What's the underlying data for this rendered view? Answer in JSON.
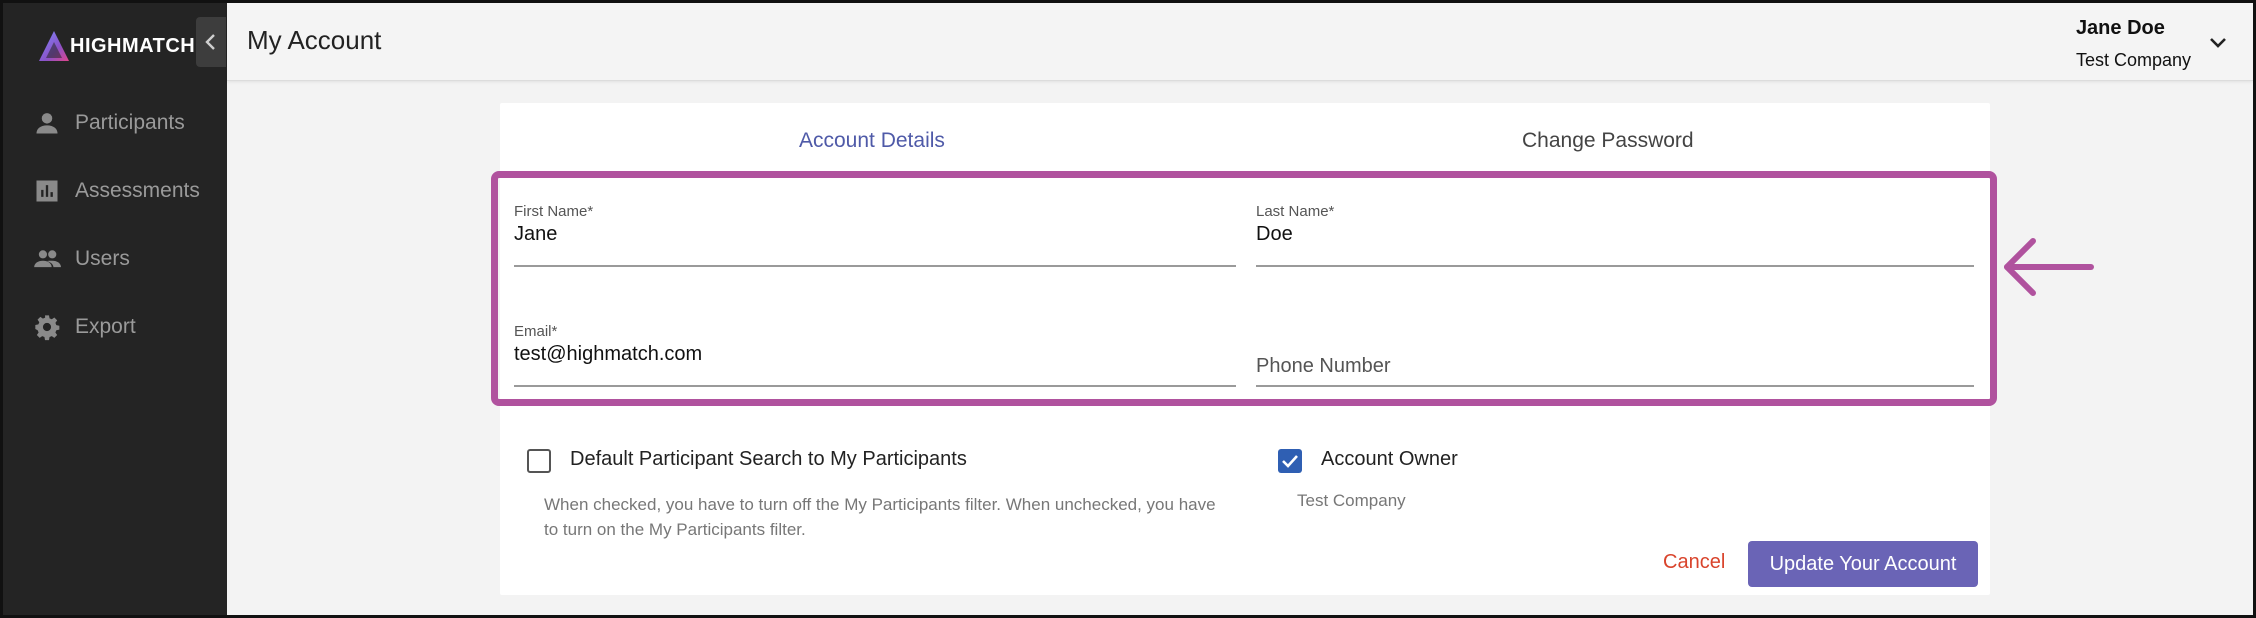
{
  "brand": {
    "name": "HIGHMATCH"
  },
  "sidebar": {
    "items": [
      {
        "label": "Participants",
        "icon": "person-icon"
      },
      {
        "label": "Assessments",
        "icon": "bar-chart-icon"
      },
      {
        "label": "Users",
        "icon": "group-icon"
      },
      {
        "label": "Export",
        "icon": "gear-icon"
      }
    ]
  },
  "header": {
    "title": "My Account",
    "user_name": "Jane Doe",
    "user_company": "Test Company"
  },
  "tabs": {
    "account": "Account Details",
    "password": "Change Password"
  },
  "form": {
    "first_name": {
      "label": "First Name*",
      "value": "Jane"
    },
    "last_name": {
      "label": "Last Name*",
      "value": "Doe"
    },
    "email": {
      "label": "Email*",
      "value": "test@highmatch.com"
    },
    "phone": {
      "placeholder": "Phone Number",
      "value": ""
    }
  },
  "options": {
    "default_search_label": "Default Participant Search to My Participants",
    "default_search_checked": false,
    "default_search_help": "When checked, you have to turn off the My Participants filter. When unchecked, you have to turn on the My Participants filter.",
    "account_owner_label": "Account Owner",
    "account_owner_checked": true,
    "account_owner_company": "Test Company"
  },
  "actions": {
    "cancel": "Cancel",
    "update": "Update Your Account"
  },
  "colors": {
    "accent": "#4f5aa8",
    "primary_button": "#6a64b6",
    "cancel": "#d9442c",
    "highlight": "#b0529e",
    "checkbox": "#2f5fb3",
    "sidebar": "#242424"
  }
}
